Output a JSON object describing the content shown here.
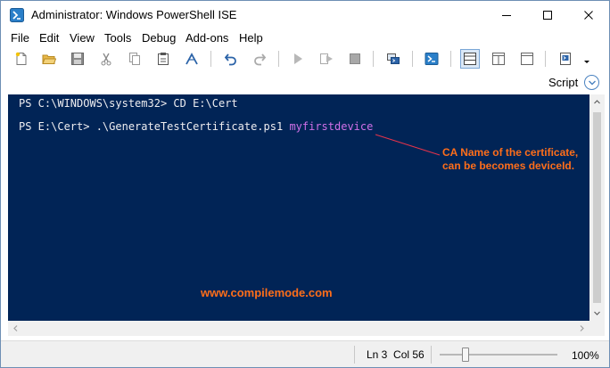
{
  "window": {
    "title": "Administrator: Windows PowerShell ISE"
  },
  "menu": {
    "items": [
      "File",
      "Edit",
      "View",
      "Tools",
      "Debug",
      "Add-ons",
      "Help"
    ]
  },
  "toolbar": {
    "icons": [
      "new-file-icon",
      "open-folder-icon",
      "save-icon",
      "cut-icon",
      "copy-icon",
      "paste-icon",
      "command-icon",
      "undo-icon",
      "redo-icon",
      "run-icon",
      "run-selection-icon",
      "stop-icon",
      "remote-powershell-icon",
      "powershell-console-icon",
      "script-pane-top-icon",
      "script-pane-right-icon",
      "script-pane-maximized-icon",
      "show-command-icon"
    ]
  },
  "script_pane": {
    "label": "Script"
  },
  "console": {
    "line1": "PS C:\\WINDOWS\\system32> CD E:\\Cert",
    "line2_prefix": "PS E:\\Cert> .\\GenerateTestCertificate.ps1 ",
    "line2_arg": "myfirstdevice",
    "annotation_line1": "CA Name of the certificate,",
    "annotation_line2": "can be becomes deviceId.",
    "watermark": "www.compilemode.com",
    "background_color": "#012456",
    "argument_color": "#d070e8",
    "annotation_color": "#ff6e1a",
    "arrow_color": "#e8334a"
  },
  "status": {
    "line_label": "Ln 3",
    "col_label": "Col 56",
    "zoom": "100%",
    "zoom_value": 100
  }
}
